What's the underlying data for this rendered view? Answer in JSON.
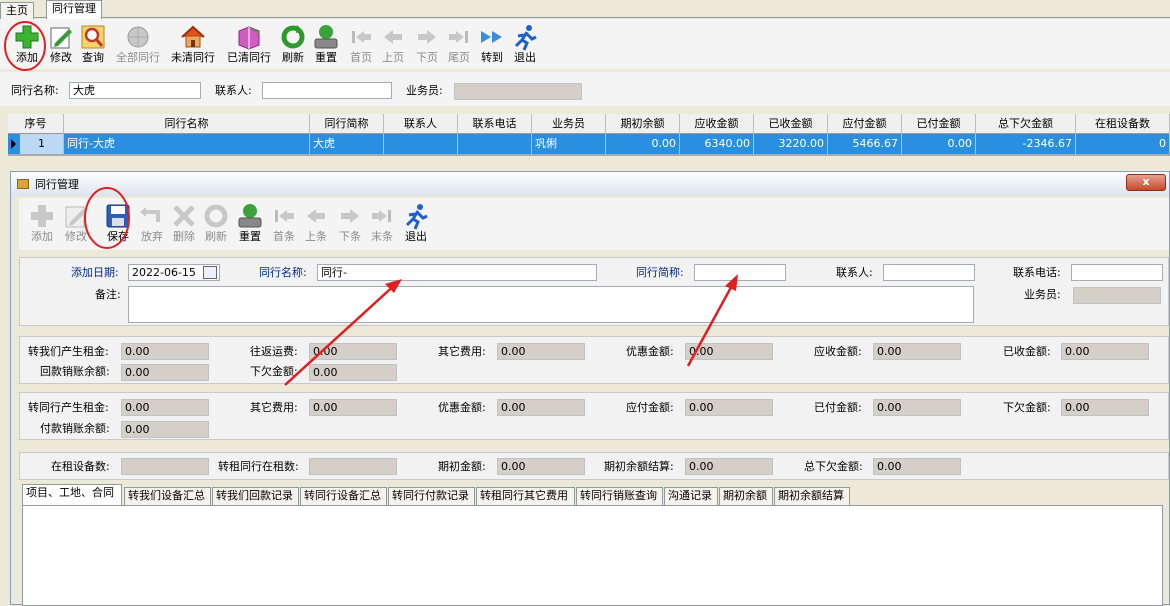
{
  "tabs": [
    {
      "label": "主页"
    },
    {
      "label": "同行管理"
    }
  ],
  "toolbar": {
    "add": "添加",
    "edit": "修改",
    "query": "查询",
    "all_peers": "全部同行",
    "uncleared": "未清同行",
    "cleared": "已清同行",
    "refresh": "刷新",
    "reset": "重置",
    "first": "首页",
    "prev": "上页",
    "next": "下页",
    "last": "尾页",
    "goto": "转到",
    "exit": "退出"
  },
  "search": {
    "name_label": "同行名称:",
    "name_value": "大虎",
    "contact_label": "联系人:",
    "contact_value": "",
    "salesman_label": "业务员:"
  },
  "grid": {
    "columns": [
      "序号",
      "同行名称",
      "同行简称",
      "联系人",
      "联系电话",
      "业务员",
      "期初余额",
      "应收金额",
      "已收金额",
      "应付金额",
      "已付金额",
      "总下欠金额",
      "在租设备数"
    ],
    "rows": [
      [
        "1",
        "同行-大虎",
        "大虎",
        "",
        "",
        "巩俐",
        "0.00",
        "6340.00",
        "3220.00",
        "5466.67",
        "0.00",
        "-2346.67",
        "0"
      ]
    ]
  },
  "dialog": {
    "title": "同行管理",
    "close": "x",
    "toolbar": {
      "add": "添加",
      "edit": "修改",
      "save": "保存",
      "discard": "放弃",
      "delete": "删除",
      "refresh": "刷新",
      "reset": "重置",
      "first": "首条",
      "prev": "上条",
      "next": "下条",
      "last": "末条",
      "exit": "退出"
    },
    "form": {
      "add_date_label": "添加日期:",
      "add_date_value": "2022-06-15",
      "name_label": "同行名称:",
      "name_value": "同行-",
      "short_label": "同行简称:",
      "short_value": "",
      "contact_label": "联系人:",
      "contact_value": "",
      "phone_label": "联系电话:",
      "phone_value": "",
      "remark_label": "备注:",
      "remark_value": "",
      "salesman_label": "业务员:"
    },
    "panel1": {
      "rent_to_us_label": "转我们产生租金:",
      "rent_to_us": "0.00",
      "freight_label": "往返运费:",
      "freight": "0.00",
      "other_fee_label": "其它费用:",
      "other_fee": "0.00",
      "discount_label": "优惠金额:",
      "discount": "0.00",
      "receivable_label": "应收金额:",
      "receivable": "0.00",
      "received_label": "已收金额:",
      "received": "0.00",
      "return_writeoff_label": "回款销账余额:",
      "return_writeoff": "0.00",
      "owed_label": "下欠金额:",
      "owed": "0.00"
    },
    "panel2": {
      "rent_to_peer_label": "转同行产生租金:",
      "rent_to_peer": "0.00",
      "other_fee_label": "其它费用:",
      "other_fee": "0.00",
      "discount_label": "优惠金额:",
      "discount": "0.00",
      "payable_label": "应付金额:",
      "payable": "0.00",
      "paid_label": "已付金额:",
      "paid": "0.00",
      "owed_label": "下欠金额:",
      "owed": "0.00",
      "pay_writeoff_label": "付款销账余额:",
      "pay_writeoff": "0.00"
    },
    "panel3": {
      "rented_label": "在租设备数:",
      "rented": "",
      "transfer_rented_label": "转租同行在租数:",
      "transfer_rented": "",
      "opening_label": "期初金额:",
      "opening": "0.00",
      "opening_settle_label": "期初余额结算:",
      "opening_settle": "0.00",
      "total_owed_label": "总下欠金额:",
      "total_owed": "0.00"
    },
    "bottom_tabs": [
      "项目、工地、合同",
      "转我们设备汇总",
      "转我们回款记录",
      "转同行设备汇总",
      "转同行付款记录",
      "转租同行其它费用",
      "转同行销账查询",
      "沟通记录",
      "期初余额",
      "期初余额结算"
    ]
  },
  "colors": {
    "selected_row": "#2a8fe0",
    "annotation_red": "#e02020"
  }
}
